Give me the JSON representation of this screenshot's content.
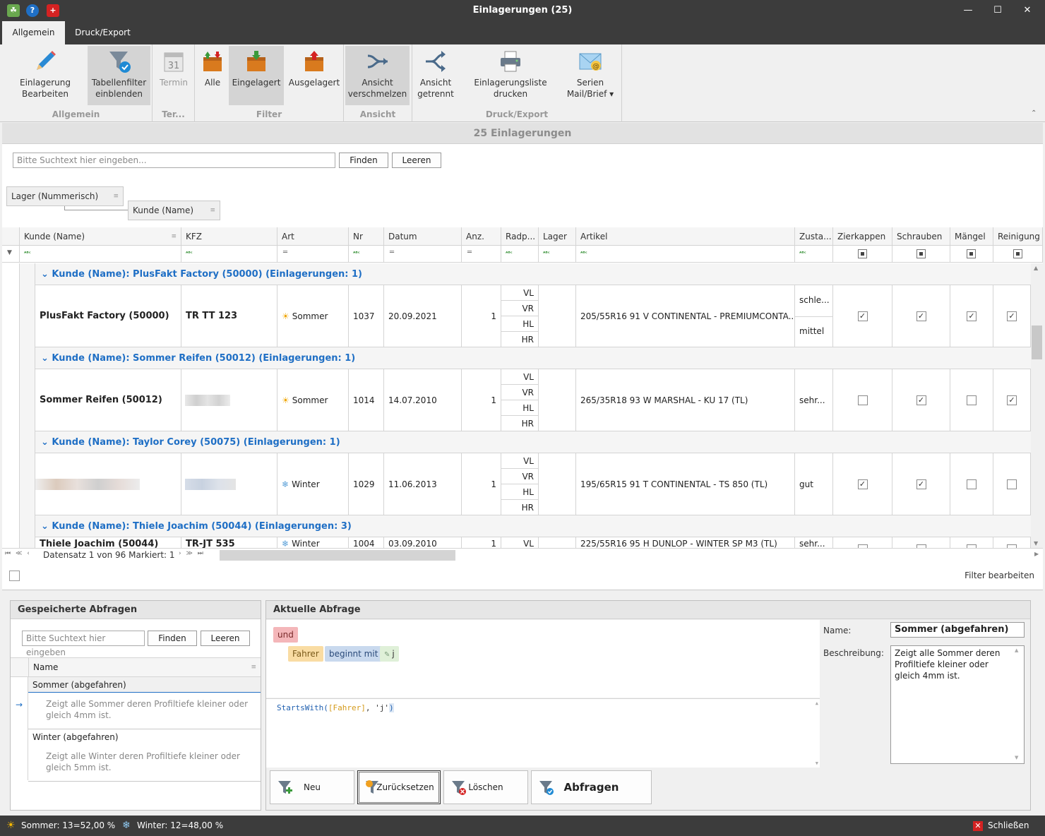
{
  "window": {
    "title": "Einlagerungen (25)"
  },
  "tabs": [
    "Allgemein",
    "Druck/Export"
  ],
  "ribbon": {
    "groups": [
      "Allgemein",
      "Ter...",
      "Filter",
      "Ansicht",
      "Druck/Export"
    ],
    "buttons": {
      "edit": "Einlagerung\nBearbeiten",
      "tablefilter": "Tabellenfilter\neinblenden",
      "termin": "Termin",
      "termin_day": "31",
      "alle": "Alle",
      "eingelagert": "Eingelagert",
      "ausgelagert": "Ausgelagert",
      "merge": "Ansicht\nverschmelzen",
      "split": "Ansicht\ngetrennt",
      "print": "Einlagerungsliste\ndrucken",
      "serial": "Serien\nMail/Brief ▾"
    }
  },
  "banner": "25 Einlagerungen",
  "search": {
    "placeholder": "Bitte Suchtext hier eingeben...",
    "find": "Finden",
    "clear": "Leeren"
  },
  "grouping": [
    "Lager (Nummerisch)",
    "Kunde (Name)"
  ],
  "columns": [
    "Kunde (Name)",
    "KFZ",
    "Art",
    "Nr",
    "Datum",
    "Anz.",
    "Radp...",
    "Lager",
    "Artikel",
    "Zusta...",
    "Zierkappen",
    "Schrauben",
    "Mängel",
    "Reinigung"
  ],
  "groups": [
    {
      "header": "Kunde (Name): PlusFakt Factory (50000)  (Einlagerungen: 1)",
      "row": {
        "kunde": "PlusFakt Factory (50000)",
        "kfz": "TR TT 123",
        "art": "Sommer",
        "nr": "1037",
        "datum": "20.09.2021",
        "anz": "1",
        "artikel": "205/55R16 91 V CONTINENTAL - PREMIUMCONTA...",
        "zustand1": "schle...",
        "zustand2": "mittel"
      }
    },
    {
      "header": "Kunde (Name): Sommer Reifen (50012)  (Einlagerungen: 1)",
      "row": {
        "kunde": "Sommer Reifen (50012)",
        "kfz": "",
        "art": "Sommer",
        "nr": "1014",
        "datum": "14.07.2010",
        "anz": "1",
        "artikel": "265/35R18 93 W MARSHAL - KU 17 (TL)",
        "zustand1": "sehr...",
        "zustand2": ""
      }
    },
    {
      "header": "Kunde (Name): Taylor Corey (50075)  (Einlagerungen: 1)",
      "row": {
        "kunde": "",
        "kfz": "",
        "art": "Winter",
        "nr": "1029",
        "datum": "11.06.2013",
        "anz": "1",
        "artikel": "195/65R15 91 T CONTINENTAL - TS 850 (TL)",
        "zustand1": "gut",
        "zustand2": ""
      }
    },
    {
      "header": "Kunde (Name): Thiele Joachim (50044)  (Einlagerungen: 3)",
      "row": {
        "kunde": "Thiele Joachim (50044)",
        "kfz": "TR-JT 535",
        "art": "Winter",
        "nr": "1004",
        "datum": "03.09.2010",
        "anz": "1",
        "artikel": "225/55R16 95 H DUNLOP - WINTER SP M3 (TL)",
        "zustand1": "sehr...",
        "zustand2": ""
      }
    }
  ],
  "wheels": [
    "VL",
    "VR",
    "HL",
    "HR"
  ],
  "nav": {
    "record": "Datensatz 1 von 96 Markiert: 1"
  },
  "filter_edit": "Filter bearbeiten",
  "saved": {
    "title": "Gespeicherte Abfragen",
    "placeholder": "Bitte Suchtext hier eingeben",
    "find": "Finden",
    "clear": "Leeren",
    "col": "Name",
    "items": [
      {
        "name": "Sommer (abgefahren)",
        "desc": "Zeigt alle Sommer deren Profiltiefe kleiner oder gleich 4mm ist."
      },
      {
        "name": "Winter (abgefahren)",
        "desc": "Zeigt alle Winter deren Profiltiefe kleiner oder gleich 5mm ist."
      }
    ]
  },
  "current": {
    "title": "Aktuelle Abfrage",
    "op": "und",
    "field": "Fahrer",
    "cond": "beginnt mit",
    "value": "j",
    "expr_fn": "StartsWith(",
    "expr_field": "[Fahrer]",
    "expr_rest": ", 'j'",
    "expr_close": ")",
    "name_label": "Name:",
    "name_value": "Sommer (abgefahren)",
    "desc_label": "Beschreibung:",
    "desc_value": "Zeigt alle Sommer deren Profiltiefe kleiner oder gleich 4mm ist.",
    "buttons": [
      "Neu",
      "Zurücksetzen",
      "Löschen",
      "Abfragen"
    ]
  },
  "status": {
    "sommer": "Sommer: 13=52,00 %",
    "winter": "Winter: 12=48,00 %",
    "close": "Schließen"
  },
  "colors": {
    "accent": "#1f6fc5",
    "titlebar": "#3c3c3c",
    "token_op": "#f4b6b9",
    "token_field": "#f9dca3",
    "token_cond": "#c9d9ee",
    "token_value": "#dff0d8"
  }
}
